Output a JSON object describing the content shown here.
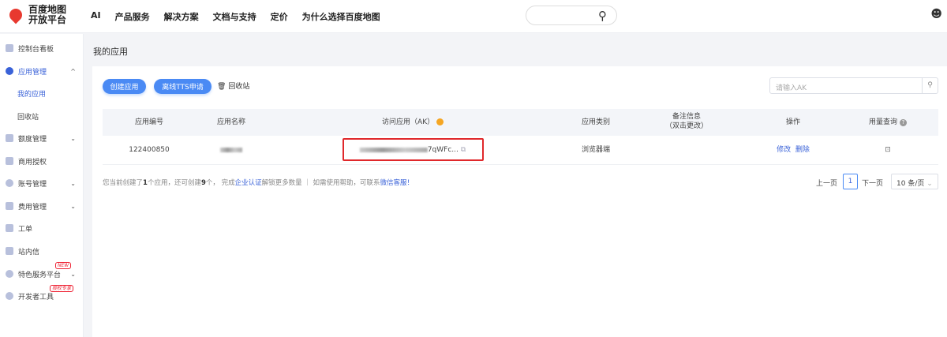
{
  "header": {
    "logo_line1": "百度地图",
    "logo_line2": "开放平台",
    "nav": [
      "AI",
      "产品服务",
      "解决方案",
      "文档与支持",
      "定价",
      "为什么选择百度地图"
    ]
  },
  "sidebar": {
    "items": [
      {
        "label": "控制台看板"
      },
      {
        "label": "应用管理"
      },
      {
        "label": "我的应用"
      },
      {
        "label": "回收站"
      },
      {
        "label": "额度管理"
      },
      {
        "label": "商用授权"
      },
      {
        "label": "账号管理"
      },
      {
        "label": "费用管理"
      },
      {
        "label": "工单"
      },
      {
        "label": "站内信"
      },
      {
        "label": "特色服务平台",
        "badge": "NEW"
      },
      {
        "label": "开发者工具",
        "badge": "授权专享"
      }
    ]
  },
  "page": {
    "title": "我的应用",
    "create_btn": "创建应用",
    "tts_btn": "离线TTS申请",
    "recycle": "回收站",
    "search_placeholder": "请输入AK"
  },
  "table": {
    "headers": [
      "应用编号",
      "应用名称",
      "访问应用（AK）",
      "应用类别",
      "备注信息",
      "（双击更改）",
      "操作",
      "用量查询"
    ],
    "rows": [
      {
        "id": "122400850",
        "ak_suffix": "7qWFc...",
        "type": "浏览器端",
        "edit": "修改",
        "delete": "删除"
      }
    ]
  },
  "footer": {
    "t1": "您当前创建了",
    "n1": "1",
    "t2": "个应用，还可创建",
    "n2": "9",
    "t3": "个， 完成",
    "link1": "企业认证",
    "t4": "解锁更多数量 ｜ 如需使用帮助，可联系",
    "link2": "微信客服！"
  },
  "pagination": {
    "prev": "上一页",
    "current": "1",
    "next": "下一页",
    "size": "10 条/页"
  }
}
